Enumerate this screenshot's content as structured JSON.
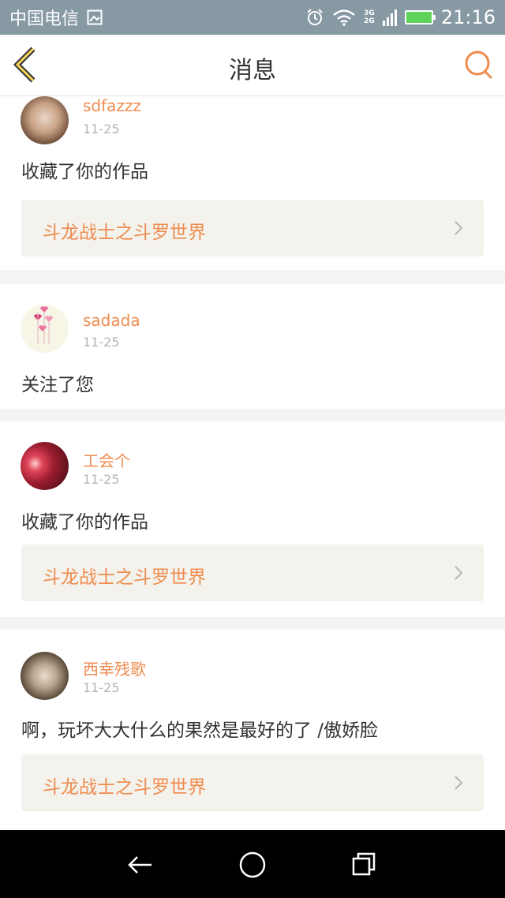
{
  "status_bar": {
    "carrier": "中国电信",
    "network_top": "3G",
    "network_bottom": "2G",
    "time": "21:16",
    "icons": [
      "image-icon",
      "alarm-icon",
      "wifi-icon",
      "signal-icon",
      "battery-charging-icon"
    ],
    "battery_color": "#5ed35a"
  },
  "header": {
    "title": "消息",
    "back_icon": "chevron-left-icon",
    "search_icon": "search-icon",
    "accent_color": "#ef8c4f"
  },
  "messages": [
    {
      "user": "sdfazzz",
      "date": "11-25",
      "action": "收藏了你的作品",
      "work": "斗龙战士之斗罗世界"
    },
    {
      "user": "sadada",
      "date": "11-25",
      "action": "关注了您"
    },
    {
      "user": "工会个",
      "date": "11-25",
      "action": "收藏了你的作品",
      "work": "斗龙战士之斗罗世界"
    },
    {
      "user": "西幸残歌",
      "date": "11-25",
      "action": "啊，玩坏大大什么的果然是最好的了 /傲娇脸",
      "work": "斗龙战士之斗罗世界"
    }
  ],
  "nav_bar": {
    "icons": [
      "back-nav-icon",
      "home-nav-icon",
      "recents-nav-icon"
    ]
  }
}
